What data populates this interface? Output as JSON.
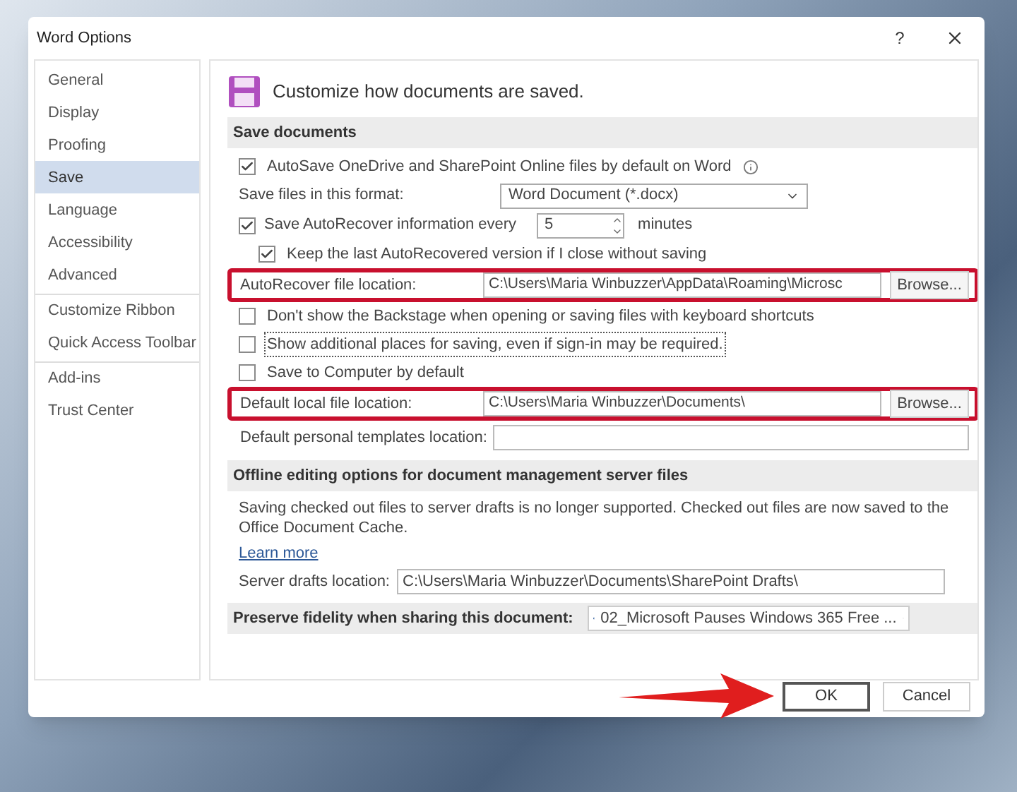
{
  "window": {
    "title": "Word Options",
    "help": "?"
  },
  "sidebar": {
    "items": [
      {
        "label": "General",
        "selected": false,
        "divider_before": false
      },
      {
        "label": "Display",
        "selected": false,
        "divider_before": false
      },
      {
        "label": "Proofing",
        "selected": false,
        "divider_before": false
      },
      {
        "label": "Save",
        "selected": true,
        "divider_before": false
      },
      {
        "label": "Language",
        "selected": false,
        "divider_before": false
      },
      {
        "label": "Accessibility",
        "selected": false,
        "divider_before": false
      },
      {
        "label": "Advanced",
        "selected": false,
        "divider_before": false
      },
      {
        "label": "Customize Ribbon",
        "selected": false,
        "divider_before": true
      },
      {
        "label": "Quick Access Toolbar",
        "selected": false,
        "divider_before": false
      },
      {
        "label": "Add-ins",
        "selected": false,
        "divider_before": true
      },
      {
        "label": "Trust Center",
        "selected": false,
        "divider_before": false
      }
    ]
  },
  "header": {
    "title": "Customize how documents are saved."
  },
  "sections": [
    {
      "title": "Save documents",
      "rows": [
        {
          "kind": "checkbox",
          "label": "AutoSave OneDrive and SharePoint Online files by default on Word",
          "checked": true,
          "info": true,
          "focused": false
        },
        {
          "kind": "dropdown",
          "label": "Save files in this format:",
          "value": "Word Document (*.docx)"
        },
        {
          "kind": "spinner",
          "label": "Save AutoRecover information every",
          "checked": true,
          "value": "5",
          "unit": "minutes",
          "children": [
            {
              "kind": "checkbox",
              "label": "Keep the last AutoRecovered version if I close without saving",
              "checked": true,
              "info": false,
              "focused": false
            }
          ]
        },
        {
          "kind": "path",
          "label": "AutoRecover file location:",
          "value": "C:\\Users\\Maria Winbuzzer\\AppData\\Roaming\\Microsc",
          "button": "Browse...",
          "highlighted": true
        },
        {
          "kind": "checkbox",
          "label": "Don't show the Backstage when opening or saving files with keyboard shortcuts",
          "checked": false,
          "info": false,
          "focused": false
        },
        {
          "kind": "checkbox",
          "label": "Show additional places for saving, even if sign-in may be required.",
          "checked": false,
          "info": false,
          "focused": true
        },
        {
          "kind": "checkbox",
          "label": "Save to Computer by default",
          "checked": false,
          "info": false,
          "focused": false
        },
        {
          "kind": "path",
          "label": "Default local file location:",
          "value": "C:\\Users\\Maria Winbuzzer\\Documents\\",
          "button": "Browse...",
          "highlighted": true
        },
        {
          "kind": "path",
          "label": "Default personal templates location:",
          "highlighted": false
        }
      ]
    },
    {
      "title": "Offline editing options for document management server files",
      "rows": [
        {
          "kind": "paragraph",
          "text": "Saving checked out files to server drafts is no longer supported. Checked out files are now saved to the Office Document Cache."
        },
        {
          "kind": "link",
          "text": "Learn more"
        },
        {
          "kind": "field",
          "label": "Server drafts location:",
          "value": "C:\\Users\\Maria Winbuzzer\\Documents\\SharePoint Drafts\\"
        }
      ]
    },
    {
      "title": "Preserve fidelity when sharing this document:",
      "dropdown": "02_Microsoft Pauses Windows 365 Free ..."
    }
  ],
  "buttons": [
    {
      "label": "OK",
      "default": true,
      "pointed": true
    },
    {
      "label": "Cancel",
      "default": false,
      "pointed": false
    }
  ]
}
